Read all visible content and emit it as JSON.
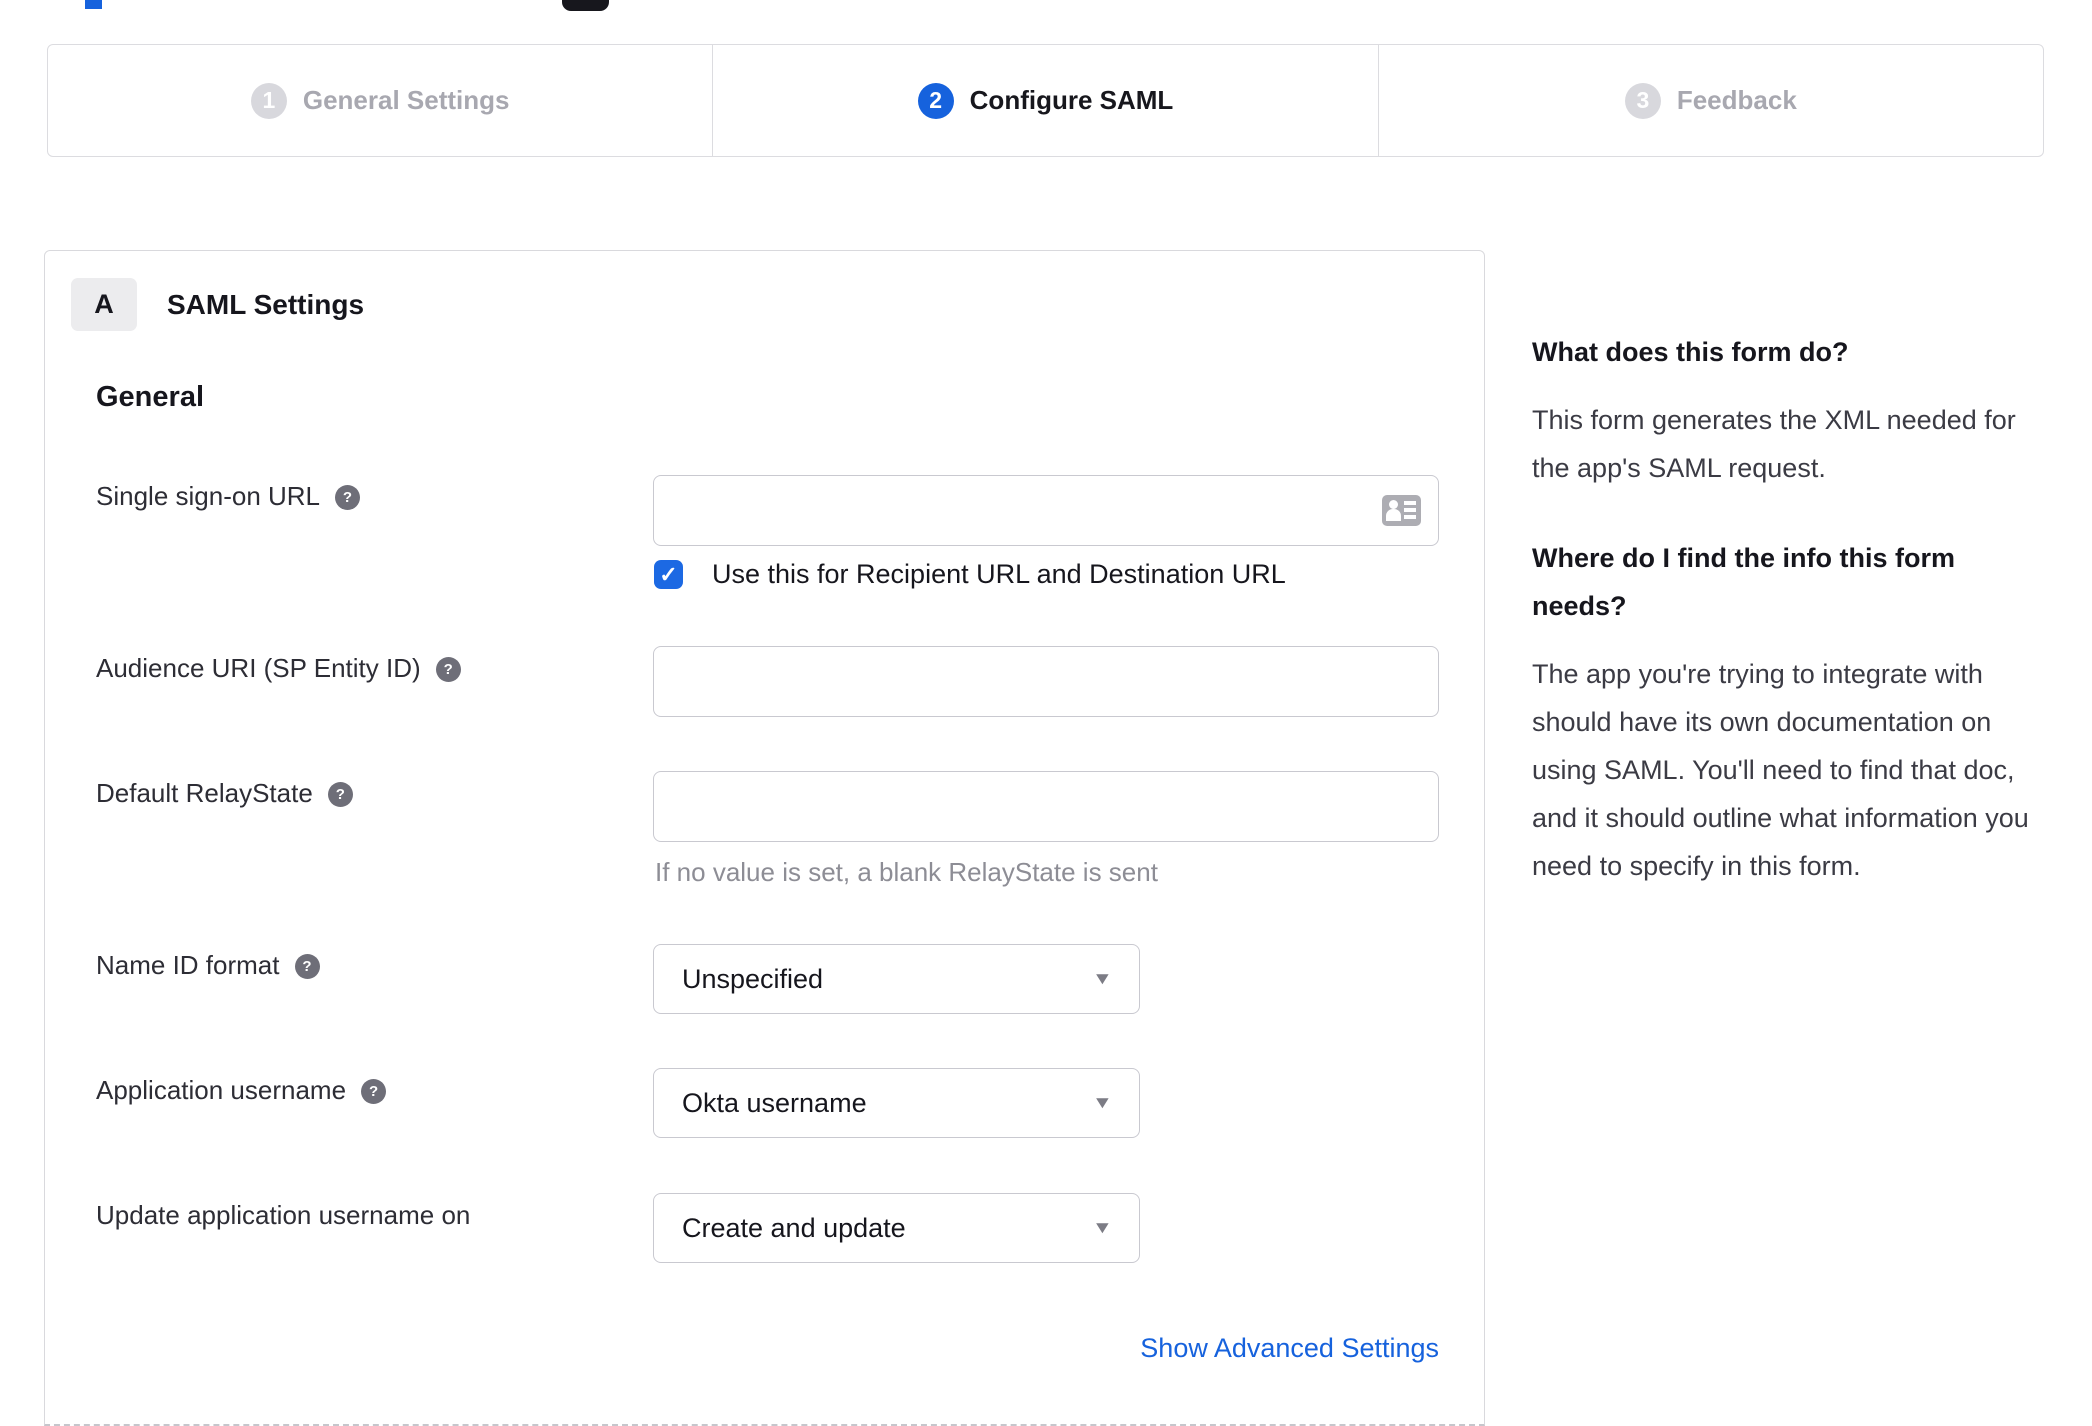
{
  "colors": {
    "accent": "#1662dd",
    "inactive_step": "#d8d8dd",
    "help_icon_bg": "#6e6e78"
  },
  "icons": {
    "help_glyph": "?",
    "checkmark_glyph": "✓",
    "caret_down_glyph": "▼"
  },
  "stepper": {
    "steps": [
      {
        "number": "1",
        "label": "General Settings",
        "state": "inactive"
      },
      {
        "number": "2",
        "label": "Configure SAML",
        "state": "active"
      },
      {
        "number": "3",
        "label": "Feedback",
        "state": "inactive"
      }
    ]
  },
  "panel": {
    "section_badge": "A",
    "section_title": "SAML Settings",
    "group_title": "General",
    "fields": {
      "sso": {
        "label": "Single sign-on URL",
        "value": "",
        "checkbox_label": "Use this for Recipient URL and Destination URL",
        "checkbox_checked": true
      },
      "audience": {
        "label": "Audience URI (SP Entity ID)",
        "value": ""
      },
      "relay": {
        "label": "Default RelayState",
        "value": "",
        "hint": "If no value is set, a blank RelayState is sent"
      },
      "nameid": {
        "label": "Name ID format",
        "value": "Unspecified"
      },
      "appuser": {
        "label": "Application username",
        "value": "Okta username"
      },
      "updateuser": {
        "label": "Update application username on",
        "value": "Create and update"
      }
    },
    "advanced_link": "Show Advanced Settings"
  },
  "help": {
    "q1": "What does this form do?",
    "a1": "This form generates the XML needed for the app's SAML request.",
    "q2": "Where do I find the info this form needs?",
    "a2": "The app you're trying to integrate with should have its own documentation on using SAML. You'll need to find that doc, and it should outline what information you need to specify in this form."
  }
}
